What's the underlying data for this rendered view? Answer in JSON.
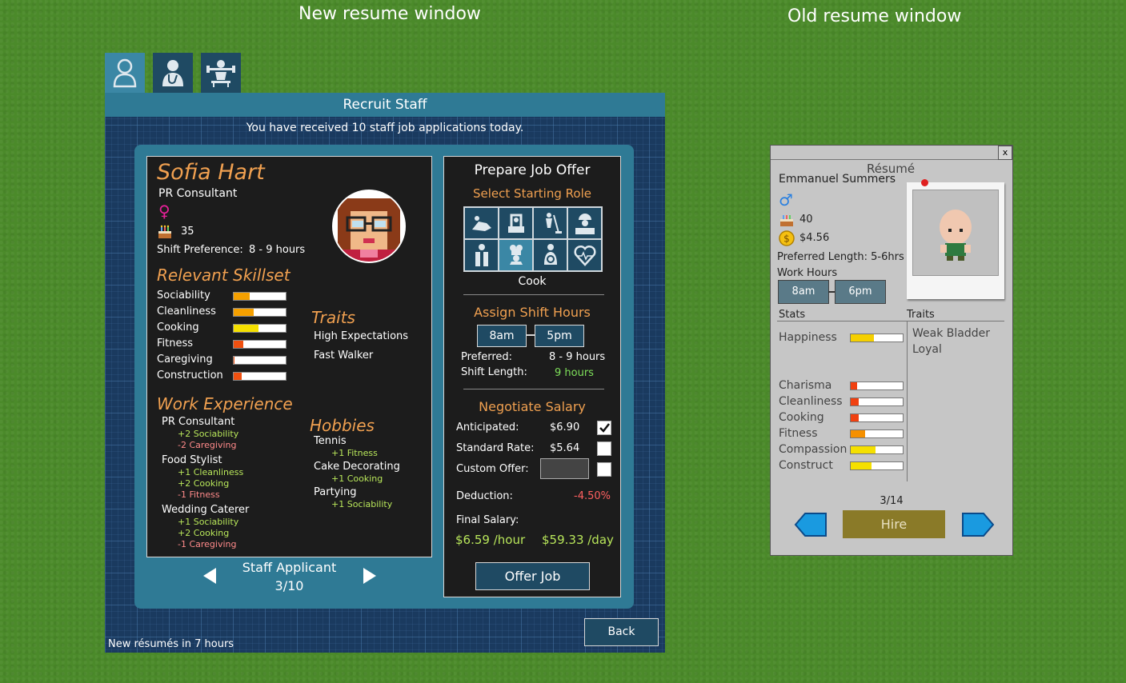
{
  "captions": {
    "new": "New resume window",
    "old": "Old resume window"
  },
  "tabs": [
    {
      "icon": "receptionist-icon"
    },
    {
      "icon": "doctor-icon"
    },
    {
      "icon": "fitness-trainer-icon"
    }
  ],
  "window": {
    "title": "Recruit Staff",
    "subtitle": "You have received 10 staff job applications today.",
    "footer": "New résumés in 7 hours",
    "back_label": "Back"
  },
  "applicant": {
    "name": "Sofia Hart",
    "job": "PR Consultant",
    "gender_symbol": "♀",
    "age": "35",
    "shift_pref_label": "Shift Preference:",
    "shift_pref_value": "8 - 9 hours",
    "skills_title": "Relevant Skillset",
    "skills": [
      {
        "name": "Sociability",
        "level": 0.3,
        "color": "#f5a000"
      },
      {
        "name": "Cleanliness",
        "level": 0.38,
        "color": "#f5a000"
      },
      {
        "name": "Cooking",
        "level": 0.48,
        "color": "#f5e000"
      },
      {
        "name": "Fitness",
        "level": 0.18,
        "color": "#f05010"
      },
      {
        "name": "Caregiving",
        "level": 0.02,
        "color": "#f05010"
      },
      {
        "name": "Construction",
        "level": 0.15,
        "color": "#f05010"
      }
    ],
    "traits_title": "Traits",
    "traits": [
      "High Expectations",
      "Fast Walker"
    ],
    "experience_title": "Work Experience",
    "experience": [
      {
        "title": "PR Consultant",
        "effects": [
          {
            "text": "+2 Sociability",
            "kind": "pos"
          },
          {
            "text": "-2 Caregiving",
            "kind": "neg"
          }
        ]
      },
      {
        "title": "Food Stylist",
        "effects": [
          {
            "text": "+1 Cleanliness",
            "kind": "pos"
          },
          {
            "text": "+2 Cooking",
            "kind": "pos"
          },
          {
            "text": "-1 Fitness",
            "kind": "neg"
          }
        ]
      },
      {
        "title": "Wedding Caterer",
        "effects": [
          {
            "text": "+1 Sociability",
            "kind": "pos"
          },
          {
            "text": "+2 Cooking",
            "kind": "pos"
          },
          {
            "text": "-1 Caregiving",
            "kind": "neg"
          }
        ]
      }
    ],
    "hobbies_title": "Hobbies",
    "hobbies": [
      {
        "title": "Tennis",
        "effect": "+1 Fitness"
      },
      {
        "title": "Cake Decorating",
        "effect": "+1 Cooking"
      },
      {
        "title": "Partying",
        "effect": "+1 Sociability"
      }
    ],
    "nav_label": "Staff Applicant",
    "nav_count": "3/10"
  },
  "offer": {
    "title": "Prepare Job Offer",
    "role_title": "Select Starting Role",
    "roles": [
      "dentist-chair-icon",
      "scanner-icon",
      "janitor-icon",
      "builder-icon",
      "waiter-icon",
      "chef-icon",
      "therapist-icon",
      "heart-care-icon"
    ],
    "selected_role_index": 5,
    "selected_role": "Cook",
    "shift_title": "Assign Shift Hours",
    "shift_start": "8am",
    "shift_end": "5pm",
    "preferred_label": "Preferred:",
    "preferred_value": "8 - 9 hours",
    "shift_length_label": "Shift Length:",
    "shift_length_value": "9 hours",
    "salary_title": "Negotiate Salary",
    "anticipated_label": "Anticipated:",
    "anticipated_value": "$6.90",
    "standard_label": "Standard Rate:",
    "standard_value": "$5.64",
    "custom_label": "Custom Offer:",
    "deduction_label": "Deduction:",
    "deduction_value": "-4.50%",
    "final_label": "Final Salary:",
    "final_hour": "$6.59 /hour",
    "final_day": "$59.33 /day",
    "offer_button": "Offer Job"
  },
  "old_resume": {
    "title": "Résumé",
    "close": "x",
    "name": "Emmanuel Summers",
    "gender_symbol": "♂",
    "age": "40",
    "wage": "$4.56",
    "pref_length": "Preferred Length: 5-6hrs",
    "work_hours_label": "Work Hours",
    "start": "8am",
    "end": "6pm",
    "stats_label": "Stats",
    "traits_label": "Traits",
    "happiness_label": "Happiness",
    "happiness_level": 0.45,
    "traits": [
      "Weak Bladder",
      "Loyal"
    ],
    "stats": [
      {
        "name": "Charisma",
        "level": 0.12,
        "color": "#f04010"
      },
      {
        "name": "Cleanliness",
        "level": 0.15,
        "color": "#f04010"
      },
      {
        "name": "Cooking",
        "level": 0.15,
        "color": "#f04010"
      },
      {
        "name": "Fitness",
        "level": 0.28,
        "color": "#f59000"
      },
      {
        "name": "Compassion",
        "level": 0.48,
        "color": "#f5e000"
      },
      {
        "name": "Construct",
        "level": 0.4,
        "color": "#f5e000"
      }
    ],
    "page": "3/14",
    "hire_label": "Hire"
  }
}
